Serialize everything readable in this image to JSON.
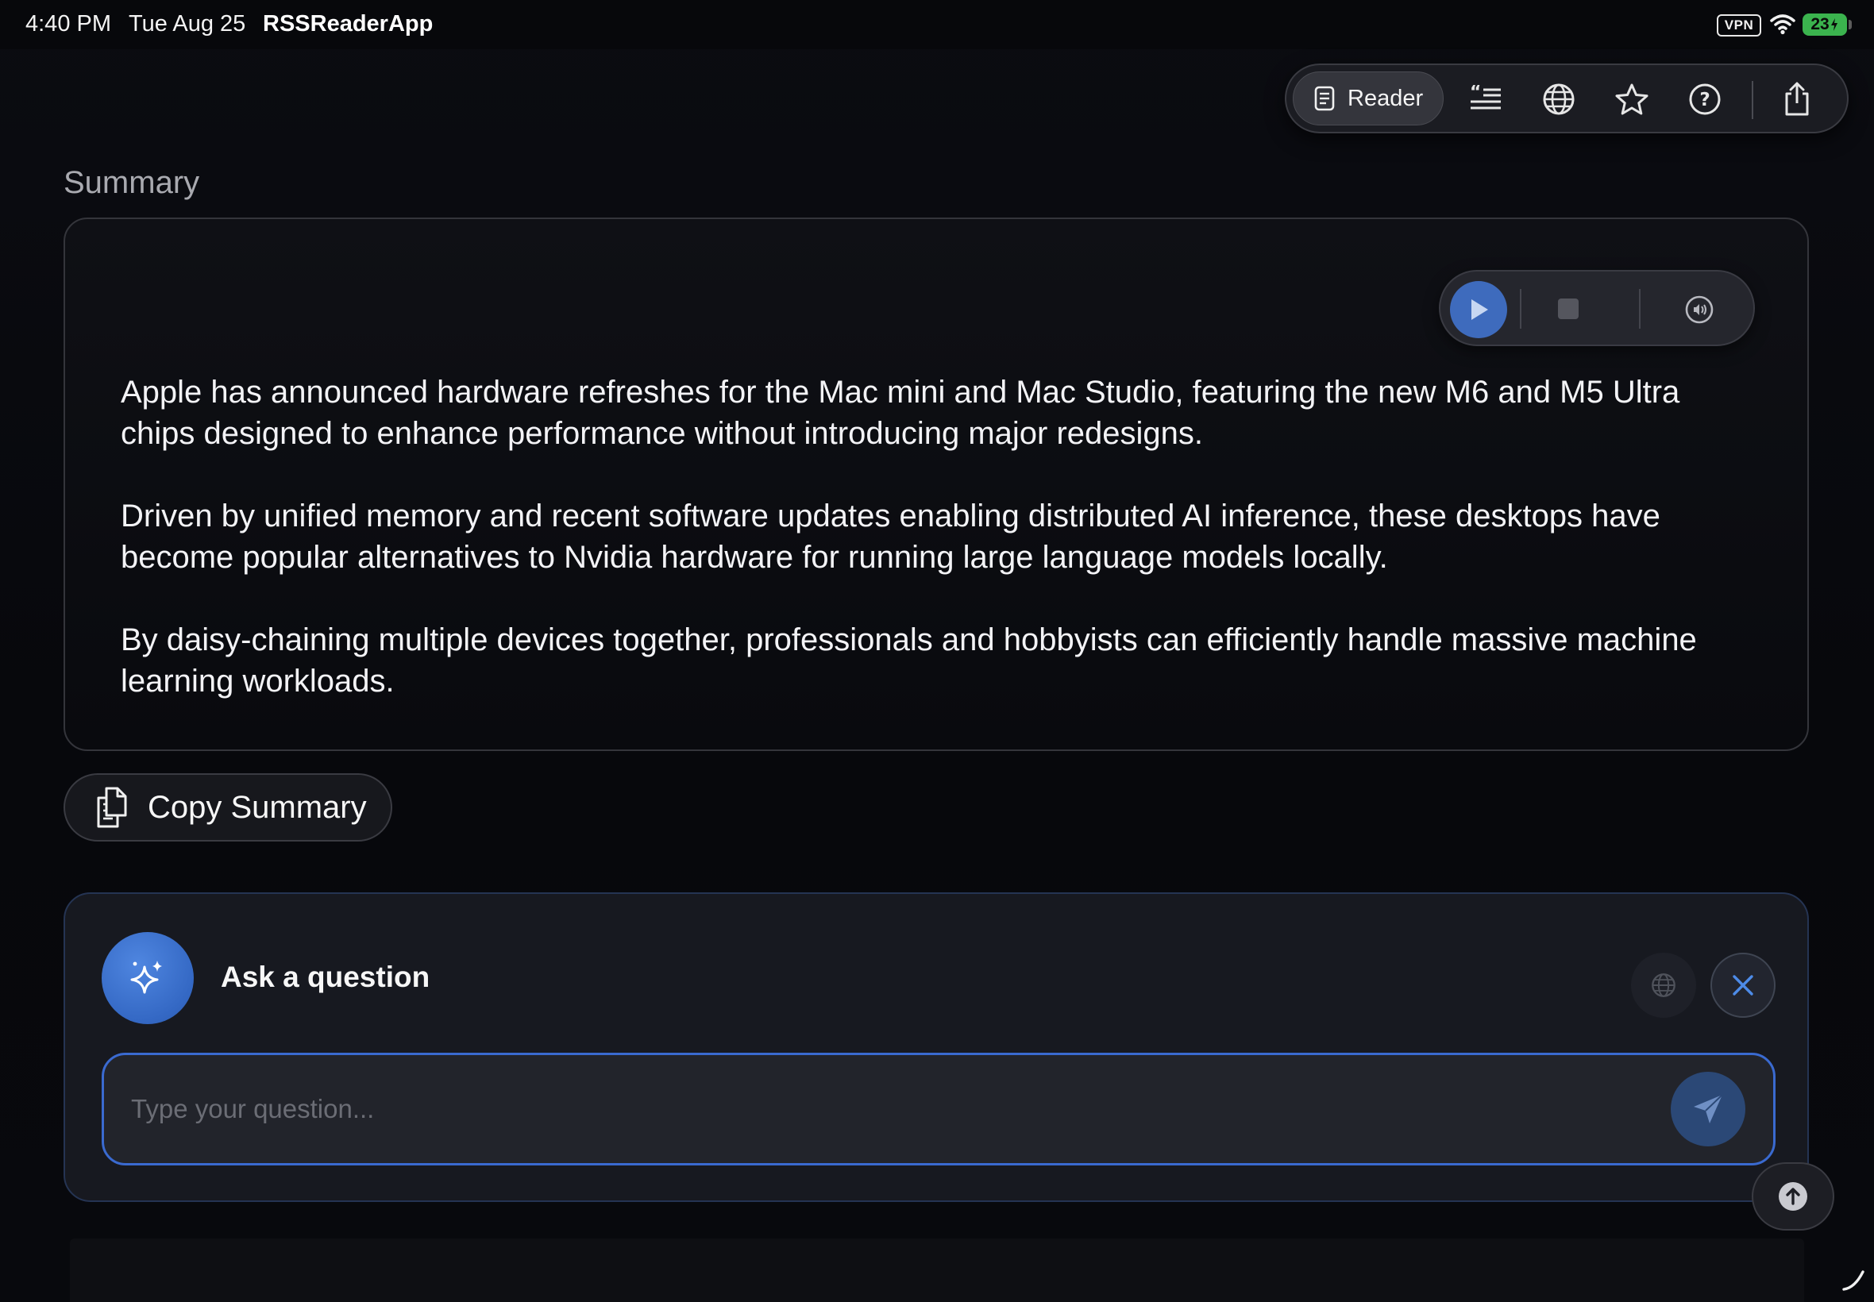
{
  "status_bar": {
    "time": "4:40 PM",
    "date": "Tue Aug 25",
    "app_name": "RSSReaderApp",
    "vpn_label": "VPN",
    "battery_level": "23"
  },
  "toolbar": {
    "reader_label": "Reader",
    "icons": [
      "reader-doc-icon",
      "quote-list-icon",
      "globe-icon",
      "star-icon",
      "help-icon",
      "share-icon"
    ]
  },
  "summary": {
    "heading": "Summary",
    "paragraphs": [
      "Apple has announced hardware refreshes for the Mac mini and Mac Studio, featuring the new M6 and M5 Ultra chips designed to enhance performance without introducing major redesigns.",
      "Driven by unified memory and recent software updates enabling distributed AI inference, these desktops have become popular alternatives to Nvidia hardware for running large language models locally.",
      "By daisy-chaining multiple devices together, professionals and hobbyists can efficiently handle massive machine learning workloads."
    ],
    "copy_label": "Copy Summary"
  },
  "ask": {
    "title": "Ask a question",
    "placeholder": "Type your question..."
  },
  "colors": {
    "accent": "#3e6bbd",
    "input_border": "#3a6ad0",
    "background": "#07080c"
  }
}
